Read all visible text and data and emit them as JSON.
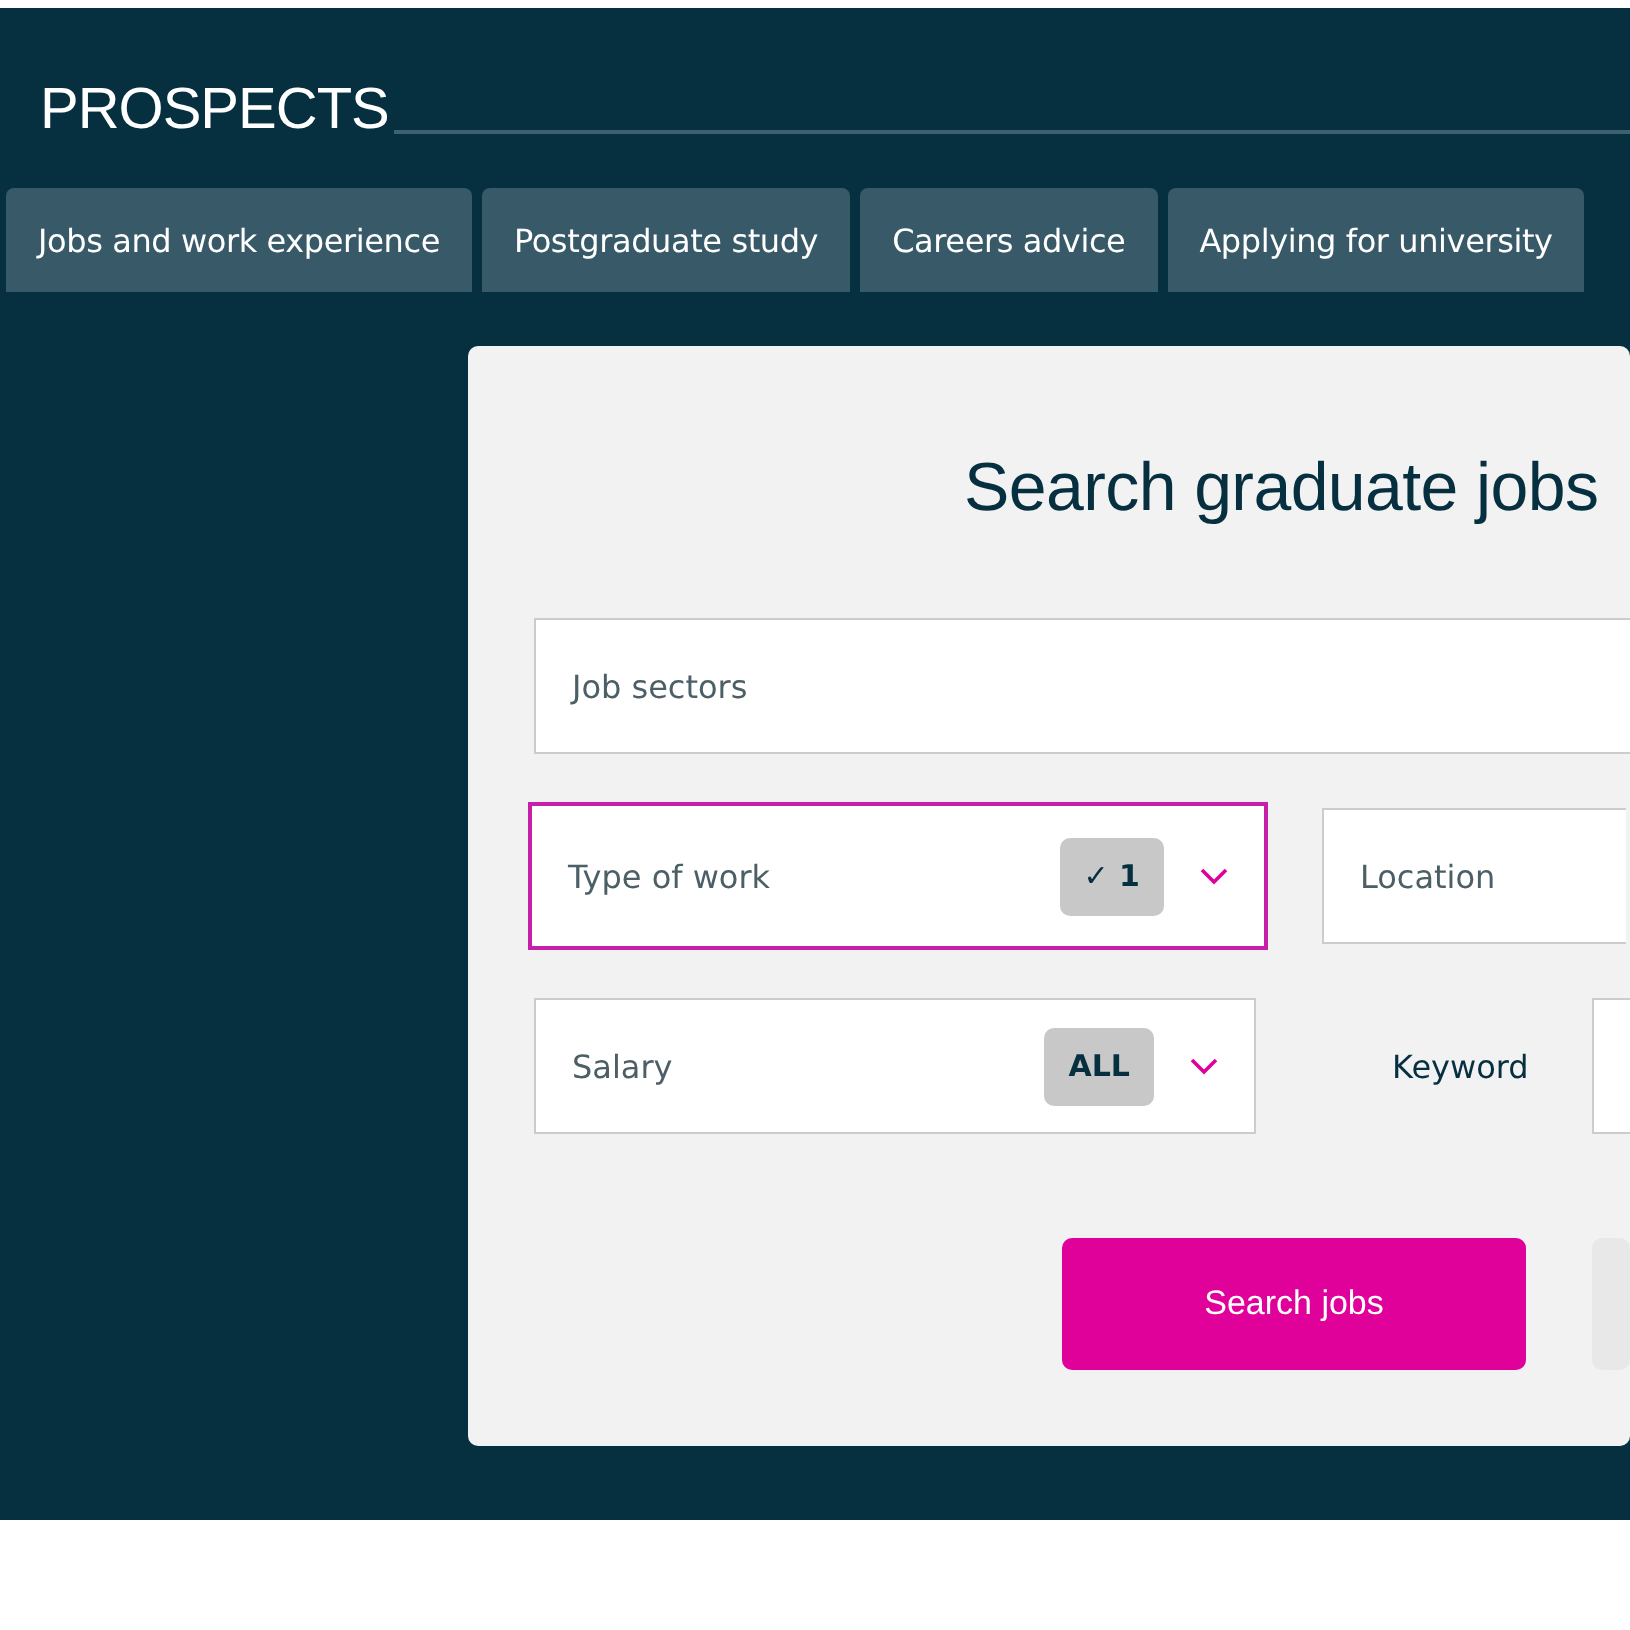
{
  "header": {
    "logo": "PROSPECTS"
  },
  "tabs": [
    {
      "label": "Jobs and work experience"
    },
    {
      "label": "Postgraduate study"
    },
    {
      "label": "Careers advice"
    },
    {
      "label": "Applying for university"
    }
  ],
  "search_panel": {
    "title": "Search graduate jobs",
    "job_sectors": {
      "placeholder": "Job sectors"
    },
    "type_of_work": {
      "label": "Type of work",
      "badge": "✓ 1",
      "selected": true
    },
    "location": {
      "placeholder": "Location"
    },
    "salary": {
      "label": "Salary",
      "badge": "ALL",
      "selected": false
    },
    "keyword": {
      "label": "Keyword"
    },
    "search_button": "Search jobs"
  }
}
